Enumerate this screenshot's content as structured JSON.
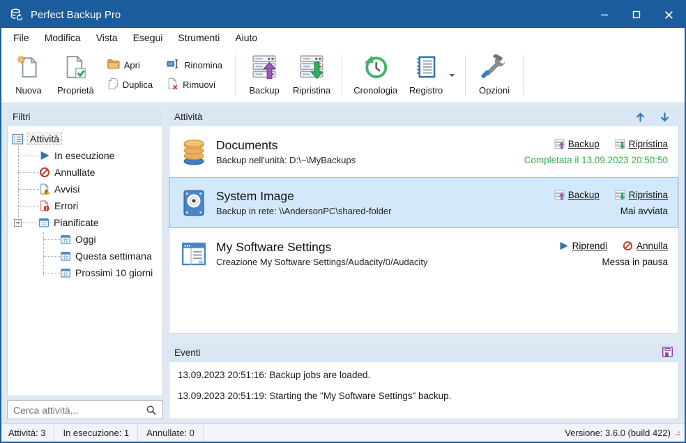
{
  "window": {
    "title": "Perfect Backup Pro"
  },
  "menu": {
    "items": [
      "File",
      "Modifica",
      "Vista",
      "Esegui",
      "Strumenti",
      "Aiuto"
    ]
  },
  "toolbar": {
    "nuova": "Nuova",
    "proprieta": "Proprietà",
    "apri": "Apri",
    "duplica": "Duplica",
    "rinomina": "Rinomina",
    "rimuovi": "Rimuovi",
    "backup": "Backup",
    "ripristina": "Ripristina",
    "cronologia": "Cronologia",
    "registro": "Registro",
    "opzioni": "Opzioni"
  },
  "sidebar": {
    "header": "Filtri",
    "search_placeholder": "Cerca attività...",
    "tree": {
      "attivita": "Attività",
      "in_esecuzione": "In esecuzione",
      "annullate": "Annullate",
      "avvisi": "Avvisi",
      "errori": "Errori",
      "pianificate": "Pianificate",
      "oggi": "Oggi",
      "questa_settimana": "Questa settimana",
      "prossimi": "Prossimi 10 giorni"
    }
  },
  "tasks_panel": {
    "header": "Attività",
    "tasks": [
      {
        "name": "Documents",
        "desc": "Backup nell'unità: D:\\~\\MyBackups",
        "actions": [
          "Backup",
          "Ripristina"
        ],
        "status": "Completata il 13.09.2023 20:50:50"
      },
      {
        "name": "System Image",
        "desc": "Backup in rete: \\\\AndersonPC\\shared-folder",
        "actions": [
          "Backup",
          "Ripristina"
        ],
        "status": "Mai avviata"
      },
      {
        "name": "My Software Settings",
        "desc": "Creazione My Software Settings/Audacity/0/Audacity",
        "actions": [
          "Riprendi",
          "Annulla"
        ],
        "status": "Messa in pausa"
      }
    ]
  },
  "events_panel": {
    "header": "Eventi",
    "entries": [
      "13.09.2023 20:51:16: Backup jobs are loaded.",
      "13.09.2023 20:51:19: Starting the \"My Software Settings\" backup."
    ]
  },
  "statusbar": {
    "attivita": "Attività: 3",
    "in_esecuzione": "In esecuzione: 1",
    "annullate": "Annullate: 0",
    "versione": "Versione: 3.6.0 (build 422)"
  },
  "colors": {
    "titlebar": "#1a5c9c",
    "panel_header": "#d9e6f3",
    "selected_row": "#d3e9fb",
    "selected_border": "#8fc3ec",
    "status_green": "#2eb04c"
  }
}
